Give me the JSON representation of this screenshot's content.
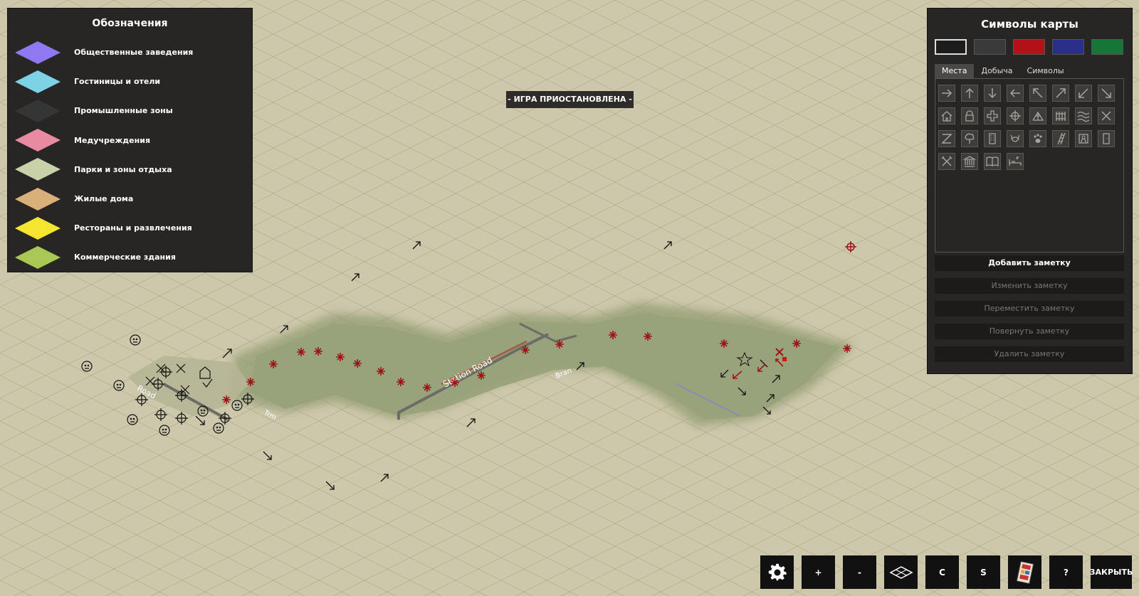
{
  "legend": {
    "title": "Обозначения",
    "items": [
      {
        "label": "Общественные заведения",
        "color": "#8f78f2"
      },
      {
        "label": "Гостиницы и отели",
        "color": "#7dd2e5"
      },
      {
        "label": "Промышленные зоны",
        "color": "#353535"
      },
      {
        "label": "Медучреждения",
        "color": "#e88aa0"
      },
      {
        "label": "Парки и зоны отдыха",
        "color": "#c9d1a8"
      },
      {
        "label": "Жилые дома",
        "color": "#d9b07a"
      },
      {
        "label": "Рестораны и развлечения",
        "color": "#f4e530"
      },
      {
        "label": "Коммерческие здания",
        "color": "#a8c755"
      }
    ]
  },
  "status": {
    "paused_text": "- ИГРА ПРИОСТАНОВЛЕНА -"
  },
  "map": {
    "street_labels": [
      "Station Road",
      "Road",
      "Trm",
      "Bran"
    ]
  },
  "symbols_panel": {
    "title": "Символы карты",
    "colors": [
      {
        "name": "black",
        "hex": "#1c1c1c",
        "selected": true
      },
      {
        "name": "dark-grey",
        "hex": "#3a3a3a",
        "selected": false
      },
      {
        "name": "red",
        "hex": "#b01217",
        "selected": false
      },
      {
        "name": "blue",
        "hex": "#2a2f8a",
        "selected": false
      },
      {
        "name": "green",
        "hex": "#157638",
        "selected": false
      }
    ],
    "tabs": [
      {
        "label": "Места",
        "active": true
      },
      {
        "label": "Добыча",
        "active": false
      },
      {
        "label": "Символы",
        "active": false
      }
    ],
    "icons": [
      "arrow-right-icon",
      "arrow-up-icon",
      "arrow-down-icon",
      "arrow-left-icon",
      "arrow-up-left-icon",
      "arrow-up-right-icon",
      "arrow-down-left-icon",
      "arrow-down-right-icon",
      "house-icon",
      "lock-icon",
      "medical-cross-icon",
      "crosshair-icon",
      "tent-icon",
      "fence-icon",
      "water-icon",
      "cross-icon",
      "sleep-z-icon",
      "tree-icon",
      "building-icon",
      "raccoon-icon",
      "paw-icon",
      "ladder-icon",
      "portrait-icon",
      "door-icon",
      "crossed-tools-icon",
      "bank-icon",
      "book-icon",
      "bed-icon"
    ],
    "buttons": [
      {
        "label": "Добавить заметку",
        "enabled": true
      },
      {
        "label": "Изменить заметку",
        "enabled": false
      },
      {
        "label": "Переместить заметку",
        "enabled": false
      },
      {
        "label": "Повернуть заметку",
        "enabled": false
      },
      {
        "label": "Удалить заметку",
        "enabled": false
      }
    ]
  },
  "toolbar": {
    "zoom_in": "+",
    "zoom_out": "-",
    "c_label": "C",
    "s_label": "S",
    "help": "?",
    "close": "ЗАКРЫТЬ",
    "icons": [
      "gear-icon",
      "isometric-toggle-icon",
      "map-sheet-icon"
    ]
  }
}
